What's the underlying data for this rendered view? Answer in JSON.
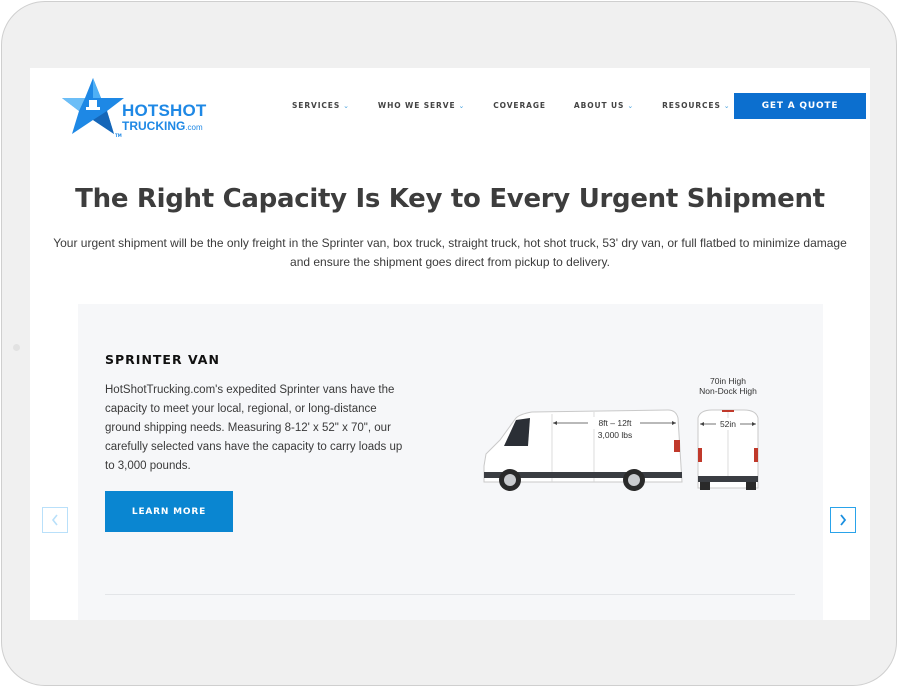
{
  "brand": {
    "name_line1": "HOTSHOT",
    "name_line2": "TRUCKING",
    "name_suffix": ".com",
    "trademark": "TM",
    "accent_color": "#1e88e5"
  },
  "nav": {
    "items": [
      {
        "label": "SERVICES",
        "has_dropdown": true
      },
      {
        "label": "WHO WE SERVE",
        "has_dropdown": true
      },
      {
        "label": "COVERAGE",
        "has_dropdown": false
      },
      {
        "label": "ABOUT US",
        "has_dropdown": true
      },
      {
        "label": "RESOURCES",
        "has_dropdown": true
      }
    ],
    "dropdown_icon": "chevron-down-icon",
    "cta_label": "GET A QUOTE",
    "cta_color": "#0c6fcf"
  },
  "hero": {
    "title": "The Right Capacity Is Key to Every Urgent Shipment",
    "subtitle_line1": "Your urgent shipment will be the only freight in the Sprinter van, box truck, straight truck, hot shot truck, 53' dry van, or full flatbed to minimize damage",
    "subtitle_line2": "and ensure the shipment goes direct from pickup to delivery."
  },
  "carousel": {
    "prev_icon": "chevron-left-icon",
    "next_icon": "chevron-right-icon",
    "slide": {
      "title": "SPRINTER VAN",
      "description": "HotShotTrucking.com's expedited Sprinter vans have the capacity to meet your local, regional, or long-distance ground shipping needs. Measuring 8-12' x 52\" x 70\", our carefully selected vans have the capacity to carry loads up to 3,000 pounds.",
      "button_label": "LEARN MORE",
      "button_color": "#0a86d1",
      "image": {
        "length_label": "8ft – 12ft",
        "weight_label": "3,000 lbs",
        "height_label_line1": "70in High",
        "height_label_line2": "Non-Dock High",
        "width_label": "52in"
      }
    }
  }
}
